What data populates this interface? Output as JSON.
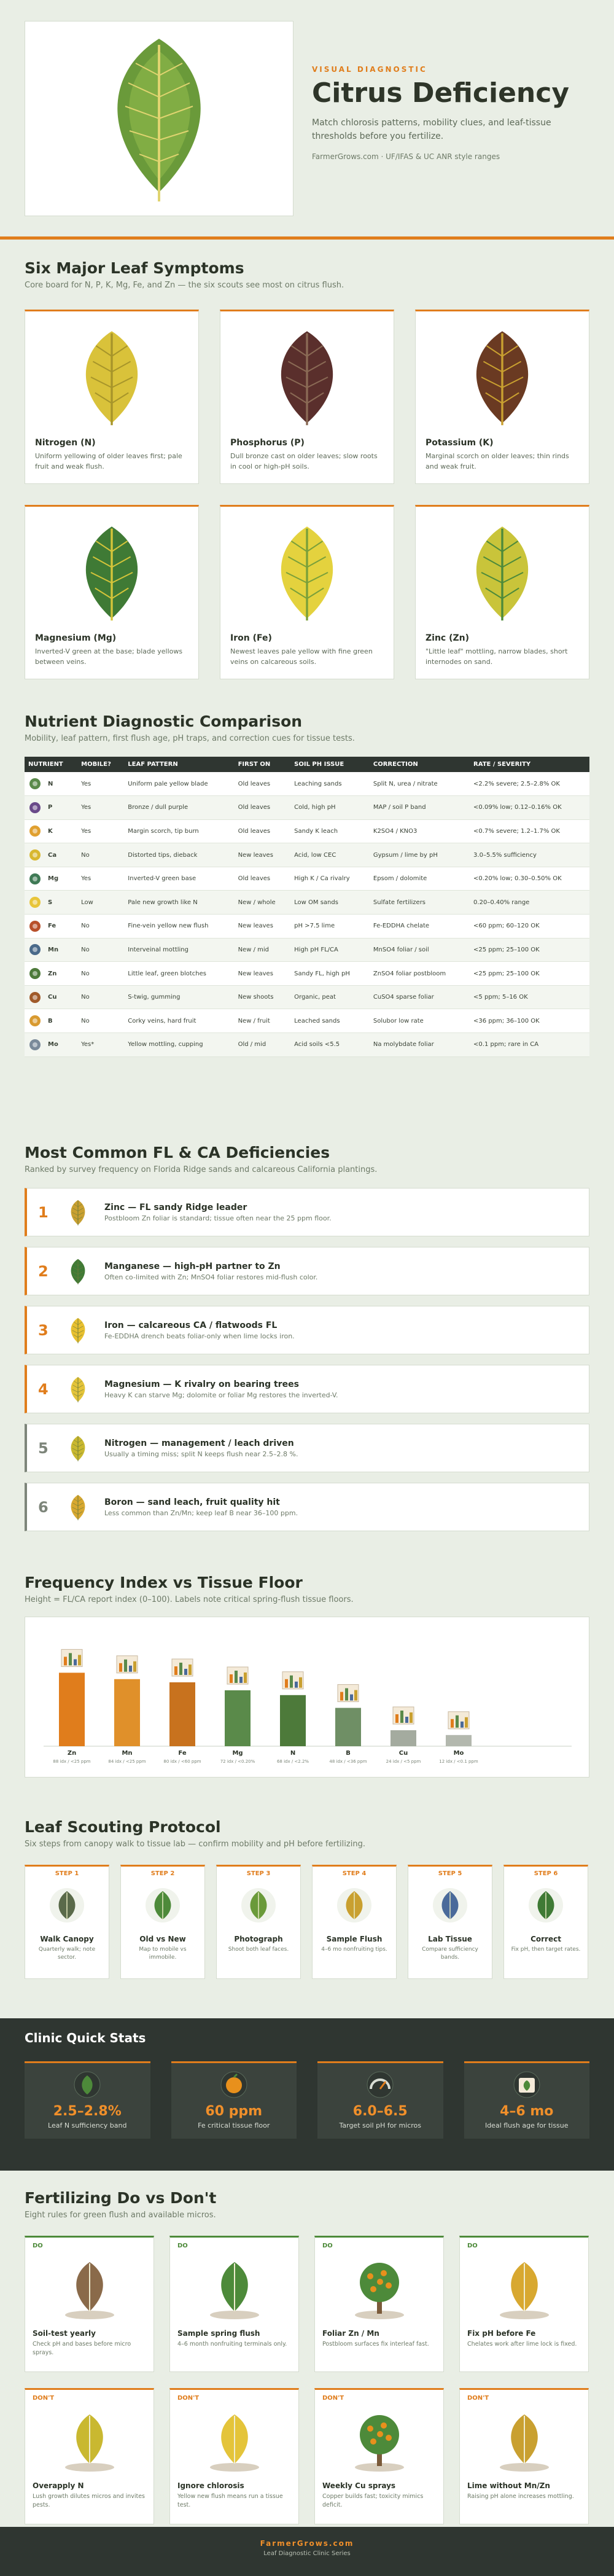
{
  "hero": {
    "eyebrow": "VISUAL DIAGNOSTIC",
    "title": "Citrus Deficiency",
    "description": "Match chlorosis patterns, mobility clues, and leaf-tissue thresholds before you fertilize.",
    "meta": "FarmerGrows.com · UF/IFAS & UC ANR style ranges"
  },
  "symptoms": {
    "title": "Six Major Leaf Symptoms",
    "subtitle": "Core board for N, P, K, Mg, Fe, and Zn — the six scouts see most on citrus flush.",
    "cards": [
      {
        "name": "Nitrogen (N)",
        "desc": "Uniform yellowing of older leaves first; pale fruit and weak flush.",
        "leaf": "#d9c23a",
        "vein": "#a7952a"
      },
      {
        "name": "Phosphorus (P)",
        "desc": "Dull bronze cast on older leaves; slow roots in cool or high-pH soils.",
        "leaf": "#5a2f2c",
        "vein": "#8a6a55"
      },
      {
        "name": "Potassium (K)",
        "desc": "Marginal scorch on older leaves; thin rinds and weak fruit.",
        "leaf": "#6a3a22",
        "vein": "#c9a030"
      },
      {
        "name": "Magnesium (Mg)",
        "desc": "Inverted-V green at the base; blade yellows between veins.",
        "leaf": "#3f7a35",
        "vein": "#d4c43a"
      },
      {
        "name": "Iron (Fe)",
        "desc": "Newest leaves pale yellow with fine green veins on calcareous soils.",
        "leaf": "#e4d23e",
        "vein": "#7aa03a"
      },
      {
        "name": "Zinc (Zn)",
        "desc": "\"Little leaf\" mottling, narrow blades, short internodes on sand.",
        "leaf": "#c9c43a",
        "vein": "#4d8a3a"
      }
    ]
  },
  "comparison": {
    "title": "Nutrient Diagnostic Comparison",
    "subtitle": "Mobility, leaf pattern, first flush age, pH traps, and correction cues for tissue tests.",
    "headers": [
      "NUTRIENT",
      "MOBILE?",
      "LEAF PATTERN",
      "FIRST ON",
      "SOIL PH ISSUE",
      "CORRECTION",
      "RATE / SEVERITY"
    ],
    "rows": [
      {
        "sym": "N",
        "color": "#5a8a4a",
        "mobile": "Yes",
        "pattern": "Uniform pale yellow blade",
        "first": "Old leaves",
        "ph": "Leaching sands",
        "fix": "Split N, urea / nitrate",
        "rate": "<2.2% severe; 2.5–2.8% OK"
      },
      {
        "sym": "P",
        "color": "#6a4a8a",
        "mobile": "Yes",
        "pattern": "Bronze / dull purple",
        "first": "Old leaves",
        "ph": "Cold, high pH",
        "fix": "MAP / soil P band",
        "rate": "<0.09% low; 0.12–0.16% OK"
      },
      {
        "sym": "K",
        "color": "#e0a030",
        "mobile": "Yes",
        "pattern": "Margin scorch, tip burn",
        "first": "Old leaves",
        "ph": "Sandy K leach",
        "fix": "K2SO4 / KNO3",
        "rate": "<0.7% severe; 1.2–1.7% OK"
      },
      {
        "sym": "Ca",
        "color": "#d8b830",
        "mobile": "No",
        "pattern": "Distorted tips, dieback",
        "first": "New leaves",
        "ph": "Acid, low CEC",
        "fix": "Gypsum / lime by pH",
        "rate": "3.0–5.5% sufficiency"
      },
      {
        "sym": "Mg",
        "color": "#3f7a55",
        "mobile": "Yes",
        "pattern": "Inverted-V green base",
        "first": "Old leaves",
        "ph": "High K / Ca rivalry",
        "fix": "Epsom / dolomite",
        "rate": "<0.20% low; 0.30–0.50% OK"
      },
      {
        "sym": "S",
        "color": "#e8c53a",
        "mobile": "Low",
        "pattern": "Pale new growth like N",
        "first": "New / whole",
        "ph": "Low OM sands",
        "fix": "Sulfate fertilizers",
        "rate": "0.20–0.40% range"
      },
      {
        "sym": "Fe",
        "color": "#b8502a",
        "mobile": "No",
        "pattern": "Fine-vein yellow new flush",
        "first": "New leaves",
        "ph": "pH >7.5 lime",
        "fix": "Fe-EDDHA chelate",
        "rate": "<60 ppm; 60–120 OK"
      },
      {
        "sym": "Mn",
        "color": "#4a6a8a",
        "mobile": "No",
        "pattern": "Interveinal mottling",
        "first": "New / mid",
        "ph": "High pH FL/CA",
        "fix": "MnSO4 foliar / soil",
        "rate": "<25 ppm; 25–100 OK"
      },
      {
        "sym": "Zn",
        "color": "#4d7a3a",
        "mobile": "No",
        "pattern": "Little leaf, green blotches",
        "first": "New leaves",
        "ph": "Sandy FL, high pH",
        "fix": "ZnSO4 foliar postbloom",
        "rate": "<25 ppm; 25–100 OK"
      },
      {
        "sym": "Cu",
        "color": "#a05a2a",
        "mobile": "No",
        "pattern": "S-twig, gumming",
        "first": "New shoots",
        "ph": "Organic, peat",
        "fix": "CuSO4 sparse foliar",
        "rate": "<5 ppm; 5–16 OK"
      },
      {
        "sym": "B",
        "color": "#d89a30",
        "mobile": "No",
        "pattern": "Corky veins, hard fruit",
        "first": "New / fruit",
        "ph": "Leached sands",
        "fix": "Solubor low rate",
        "rate": "<36 ppm; 36–100 OK"
      },
      {
        "sym": "Mo",
        "color": "#7a8a9a",
        "mobile": "Yes*",
        "pattern": "Yellow mottling, cupping",
        "first": "Old / mid",
        "ph": "Acid soils <5.5",
        "fix": "Na molybdate foliar",
        "rate": "<0.1 ppm; rare in CA"
      }
    ]
  },
  "common": {
    "title": "Most Common FL & CA Deficiencies",
    "subtitle": "Ranked by survey frequency on Florida Ridge sands and calcareous California plantings.",
    "items": [
      {
        "rank": "1",
        "title": "Zinc — FL sandy Ridge leader",
        "desc": "Postbloom Zn foliar is standard; tissue often near the 25 ppm floor.",
        "color": "#c9a030",
        "tone": "orange"
      },
      {
        "rank": "2",
        "title": "Manganese — high-pH partner to Zn",
        "desc": "Often co-limited with Zn; MnSO4 foliar restores mid-flush color.",
        "color": "#3f7a35",
        "tone": "orange"
      },
      {
        "rank": "3",
        "title": "Iron — calcareous CA / flatwoods FL",
        "desc": "Fe-EDDHA drench beats foliar-only when lime locks iron.",
        "color": "#e8c030",
        "tone": "orange"
      },
      {
        "rank": "4",
        "title": "Magnesium — K rivalry on bearing trees",
        "desc": "Heavy K can starve Mg; dolomite or foliar Mg restores the inverted-V.",
        "color": "#e4c43a",
        "tone": "orange"
      },
      {
        "rank": "5",
        "title": "Nitrogen — management / leach driven",
        "desc": "Usually a timing miss; split N keeps flush near 2.5–2.8 %.",
        "color": "#c9b830",
        "tone": "gray"
      },
      {
        "rank": "6",
        "title": "Boron — sand leach, fruit quality hit",
        "desc": "Less common than Zn/Mn; keep leaf B near 36–100 ppm.",
        "color": "#d8a830",
        "tone": "gray"
      }
    ]
  },
  "frequency": {
    "title": "Frequency Index vs Tissue Floor",
    "subtitle": "Height = FL/CA report index (0–100). Labels note critical spring-flush tissue floors."
  },
  "chart_data": {
    "type": "bar",
    "categories": [
      "Zn",
      "Mn",
      "Fe",
      "Mg",
      "N",
      "B",
      "Cu",
      "Mo"
    ],
    "values": [
      92,
      84,
      80,
      70,
      64,
      48,
      20,
      14
    ],
    "floors": [
      "88 idx / <25 ppm",
      "84 idx / <25 ppm",
      "80 idx / <60 ppm",
      "72 idx / <0.20%",
      "68 idx / <2.2%",
      "48 idx / <36 ppm",
      "24 idx / <5 ppm",
      "12 idx / <0.1 ppm"
    ],
    "colors": [
      "#e07d1c",
      "#e0902a",
      "#c8721e",
      "#5a8a4a",
      "#4d7a3a",
      "#6f8f65",
      "#a4ab9f",
      "#b3b8ae"
    ],
    "ylim": [
      0,
      100
    ]
  },
  "protocol": {
    "title": "Leaf Scouting Protocol",
    "subtitle": "Six steps from canopy walk to tissue lab — confirm mobility and pH before fertilizing.",
    "steps": [
      {
        "label": "STEP 1",
        "title": "Walk Canopy",
        "desc": "Quarterly walk; note sector."
      },
      {
        "label": "STEP 2",
        "title": "Old vs New",
        "desc": "Map to mobile vs immobile."
      },
      {
        "label": "STEP 3",
        "title": "Photograph",
        "desc": "Shoot both leaf faces."
      },
      {
        "label": "STEP 4",
        "title": "Sample Flush",
        "desc": "4–6 mo nonfruiting tips."
      },
      {
        "label": "STEP 5",
        "title": "Lab Tissue",
        "desc": "Compare sufficiency bands."
      },
      {
        "label": "STEP 6",
        "title": "Correct",
        "desc": "Fix pH, then target rates."
      }
    ]
  },
  "stats": {
    "title": "Clinic Quick Stats",
    "items": [
      {
        "value": "2.5–2.8%",
        "label": "Leaf N sufficiency band"
      },
      {
        "value": "60 ppm",
        "label": "Fe critical tissue floor"
      },
      {
        "value": "6.0–6.5",
        "label": "Target soil pH for micros"
      },
      {
        "value": "4–6 mo",
        "label": "Ideal flush age for tissue"
      }
    ]
  },
  "dodont": {
    "title": "Fertilizing Do vs Don't",
    "subtitle": "Eight rules for green flush and available micros.",
    "cards": [
      {
        "kind": "do",
        "tag": "DO",
        "title": "Soil-test yearly",
        "desc": "Check pH and bases before micro sprays."
      },
      {
        "kind": "do",
        "tag": "DO",
        "title": "Sample spring flush",
        "desc": "4–6 month nonfruiting terminals only."
      },
      {
        "kind": "do",
        "tag": "DO",
        "title": "Foliar Zn / Mn",
        "desc": "Postbloom surfaces fix interleaf fast."
      },
      {
        "kind": "do",
        "tag": "DO",
        "title": "Fix pH before Fe",
        "desc": "Chelates work after lime lock is fixed."
      },
      {
        "kind": "dont",
        "tag": "DON'T",
        "title": "Overapply N",
        "desc": "Lush growth dilutes micros and invites pests."
      },
      {
        "kind": "dont",
        "tag": "DON'T",
        "title": "Ignore chlorosis",
        "desc": "Yellow new flush means run a tissue test."
      },
      {
        "kind": "dont",
        "tag": "DON'T",
        "title": "Weekly Cu sprays",
        "desc": "Copper builds fast; toxicity mimics deficit."
      },
      {
        "kind": "dont",
        "tag": "DON'T",
        "title": "Lime without Mn/Zn",
        "desc": "Raising pH alone increases mottling."
      }
    ]
  },
  "footer": {
    "brand": "FarmerGrows.com",
    "sub": "Leaf Diagnostic Clinic Series"
  }
}
